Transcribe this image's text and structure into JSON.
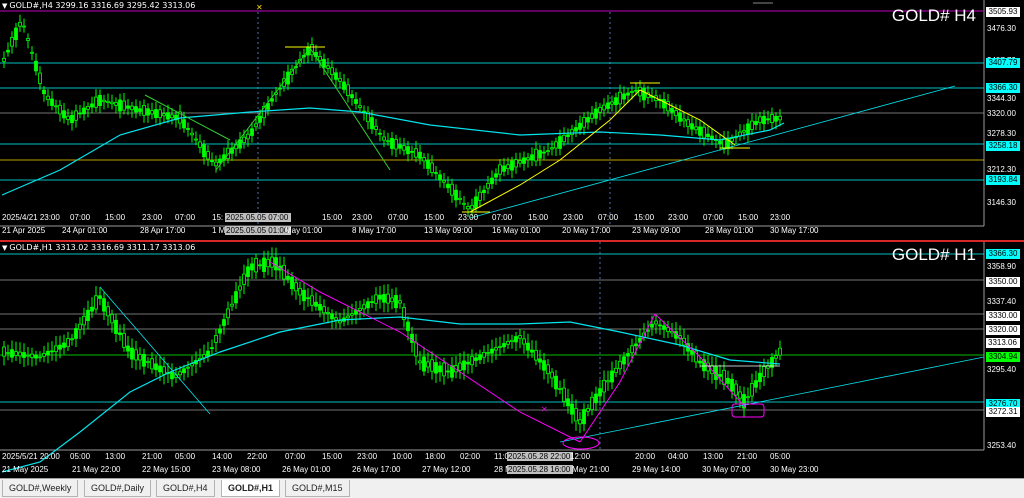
{
  "top_pane": {
    "header": "GOLD#,H4  3299.16 3316.69 3295.42 3313.06",
    "title": "GOLD# H4",
    "price_ticks": [
      "3476.30",
      "3407.79",
      "3344.30",
      "3320.00",
      "3278.30",
      "3212.30",
      "3146.30"
    ],
    "price_tags": [
      {
        "text": "3505.93",
        "bg": "#ffffff",
        "fg": "#000000"
      },
      {
        "text": "3407.79",
        "bg": "#00ffff",
        "fg": "#000000"
      },
      {
        "text": "3366.30",
        "bg": "#00ffff",
        "fg": "#000000"
      },
      {
        "text": "3258.18",
        "bg": "#00ffff",
        "fg": "#000000"
      },
      {
        "text": "3193.84",
        "bg": "#00ffff",
        "fg": "#000000"
      }
    ],
    "time_labels": [
      "2025/4/21 23:00",
      "07:00",
      "15:00",
      "23:00",
      "07:00",
      "15:",
      "2025.05.05 07:00",
      "15:00",
      "23:00",
      "07:00",
      "15:00",
      "23:00",
      "07:00",
      "15:00",
      "23:00",
      "07:00",
      "15:00",
      "23:00",
      "07:00",
      "15:00",
      "23:00"
    ],
    "time_labels2": [
      "21 Apr 2025",
      "24 Apr 01:00",
      "28 Apr 17:00",
      "1 M",
      "2025.05.05 01:00",
      "May 01:00",
      "8 May 17:00",
      "13 May 09:00",
      "16 May 01:00",
      "20 May 17:00",
      "23 May 09:00",
      "28 May 01:00",
      "30 May 17:00"
    ]
  },
  "bottom_pane": {
    "header": "GOLD#,H1  3313.02 3316.69 3311.17 3313.06",
    "title": "GOLD# H1",
    "price_ticks": [
      "3358.90",
      "3337.40",
      "3313.06",
      "3295.40",
      "3253.40"
    ],
    "price_tags": [
      {
        "text": "3366.30",
        "bg": "#00ffff",
        "fg": "#000000"
      },
      {
        "text": "3350.00",
        "bg": "#ffffff",
        "fg": "#000000"
      },
      {
        "text": "3330.00",
        "bg": "#ffffff",
        "fg": "#000000"
      },
      {
        "text": "3320.00",
        "bg": "#ffffff",
        "fg": "#000000"
      },
      {
        "text": "3304.94",
        "bg": "#00ff00",
        "fg": "#000000"
      },
      {
        "text": "3276.70",
        "bg": "#00ffff",
        "fg": "#000000"
      },
      {
        "text": "3272.31",
        "bg": "#ffffff",
        "fg": "#000000"
      }
    ],
    "time_labels": [
      "2025/5/21 20:00",
      "05:00",
      "13:00",
      "21:00",
      "05:00",
      "14:00",
      "22:00",
      "07:00",
      "15:00",
      "23:00",
      "10:00",
      "18:00",
      "02:00",
      "11:00",
      "2025.05.28 22:00",
      "12:00",
      "20:00",
      "04:00",
      "13:00",
      "21:00",
      "05:00"
    ],
    "time_labels2": [
      "21 May 2025",
      "21 May 22:00",
      "22 May 15:00",
      "23 May 08:00",
      "26 May 01:00",
      "26 May 17:00",
      "27 May 12:00",
      "28 M",
      "2025.05.28 16:00",
      "May 21:00",
      "29 May 14:00",
      "30 May 07:00",
      "30 May 23:00"
    ]
  },
  "tabs": [
    "GOLD#,Weekly",
    "GOLD#,Daily",
    "GOLD#,H4",
    "GOLD#,H1",
    "GOLD#,M15"
  ],
  "active_tab": "GOLD#,H1",
  "colors": {
    "candle": "#00ff00",
    "ma": "#00e5ee",
    "trend_yellow": "#ffff00",
    "trend_green": "#32cd32",
    "trend_magenta": "#ff00ff",
    "grid": "#7f7f7f"
  }
}
